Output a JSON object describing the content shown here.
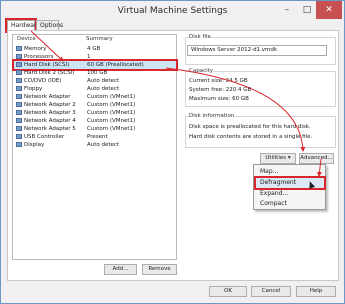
{
  "window": {
    "title": "Virtual Machine Settings",
    "controls": {
      "minimize": "–",
      "maximize": "□",
      "close": "✕"
    }
  },
  "tabs": [
    {
      "label": "Hardware",
      "active": true
    },
    {
      "label": "Options",
      "active": false
    }
  ],
  "device_list": {
    "headers": {
      "device": "Device",
      "summary": "Summary"
    },
    "rows": [
      {
        "icon": "memory-icon",
        "device": "Memory",
        "summary": "4 GB",
        "selected": false
      },
      {
        "icon": "processor-icon",
        "device": "Processors",
        "summary": "1",
        "selected": false
      },
      {
        "icon": "hard-disk-icon",
        "device": "Hard Disk (SCSI)",
        "summary": "60 GB (Preallocated)",
        "selected": true
      },
      {
        "icon": "hard-disk-icon",
        "device": "Hard Disk 2 (SCSI)",
        "summary": "100 GB",
        "selected": false
      },
      {
        "icon": "cd-dvd-icon",
        "device": "CD/DVD (IDE)",
        "summary": "Auto detect",
        "selected": false
      },
      {
        "icon": "floppy-icon",
        "device": "Floppy",
        "summary": "Auto detect",
        "selected": false
      },
      {
        "icon": "network-adapter-icon",
        "device": "Network Adapter",
        "summary": "Custom (VMnet1)",
        "selected": false
      },
      {
        "icon": "network-adapter-icon",
        "device": "Network Adapter 2",
        "summary": "Custom (VMnet1)",
        "selected": false
      },
      {
        "icon": "network-adapter-icon",
        "device": "Network Adapter 3",
        "summary": "Custom (VMnet1)",
        "selected": false
      },
      {
        "icon": "network-adapter-icon",
        "device": "Network Adapter 4",
        "summary": "Custom (VMnet1)",
        "selected": false
      },
      {
        "icon": "network-adapter-icon",
        "device": "Network Adapter 5",
        "summary": "Custom (VMnet1)",
        "selected": false
      },
      {
        "icon": "usb-icon",
        "device": "USB Controller",
        "summary": "Present",
        "selected": false
      },
      {
        "icon": "display-icon",
        "device": "Display",
        "summary": "Auto detect",
        "selected": false
      }
    ],
    "add_label": "Add...",
    "remove_label": "Remove"
  },
  "disk_file": {
    "group_label": "Disk file",
    "value": "Windows Server 2012-d1.vmdk"
  },
  "capacity": {
    "group_label": "Capacity",
    "current_size": "Current size: 24.5 GB",
    "system_free": "System free: 220.4 GB",
    "maximum_size": "Maximum size: 60 GB"
  },
  "disk_information": {
    "group_label": "Disk information",
    "line1": "Disk space is preallocated for this hard disk.",
    "line2": "Hard disk contents are stored in a single file."
  },
  "utilities": {
    "button_label": "Utilities",
    "advanced_label": "Advanced...",
    "menu": [
      {
        "label": "Map...",
        "highlighted": false
      },
      {
        "label": "Defragment",
        "highlighted": true
      },
      {
        "label": "Expand...",
        "highlighted": false
      },
      {
        "label": "Compact",
        "highlighted": false
      }
    ]
  },
  "footer": {
    "ok_label": "OK",
    "cancel_label": "Cancel",
    "help_label": "Help"
  },
  "colors": {
    "annotation_red": "#d9262c",
    "selection": "#cce4f7",
    "window_border": "#6d97c4"
  }
}
